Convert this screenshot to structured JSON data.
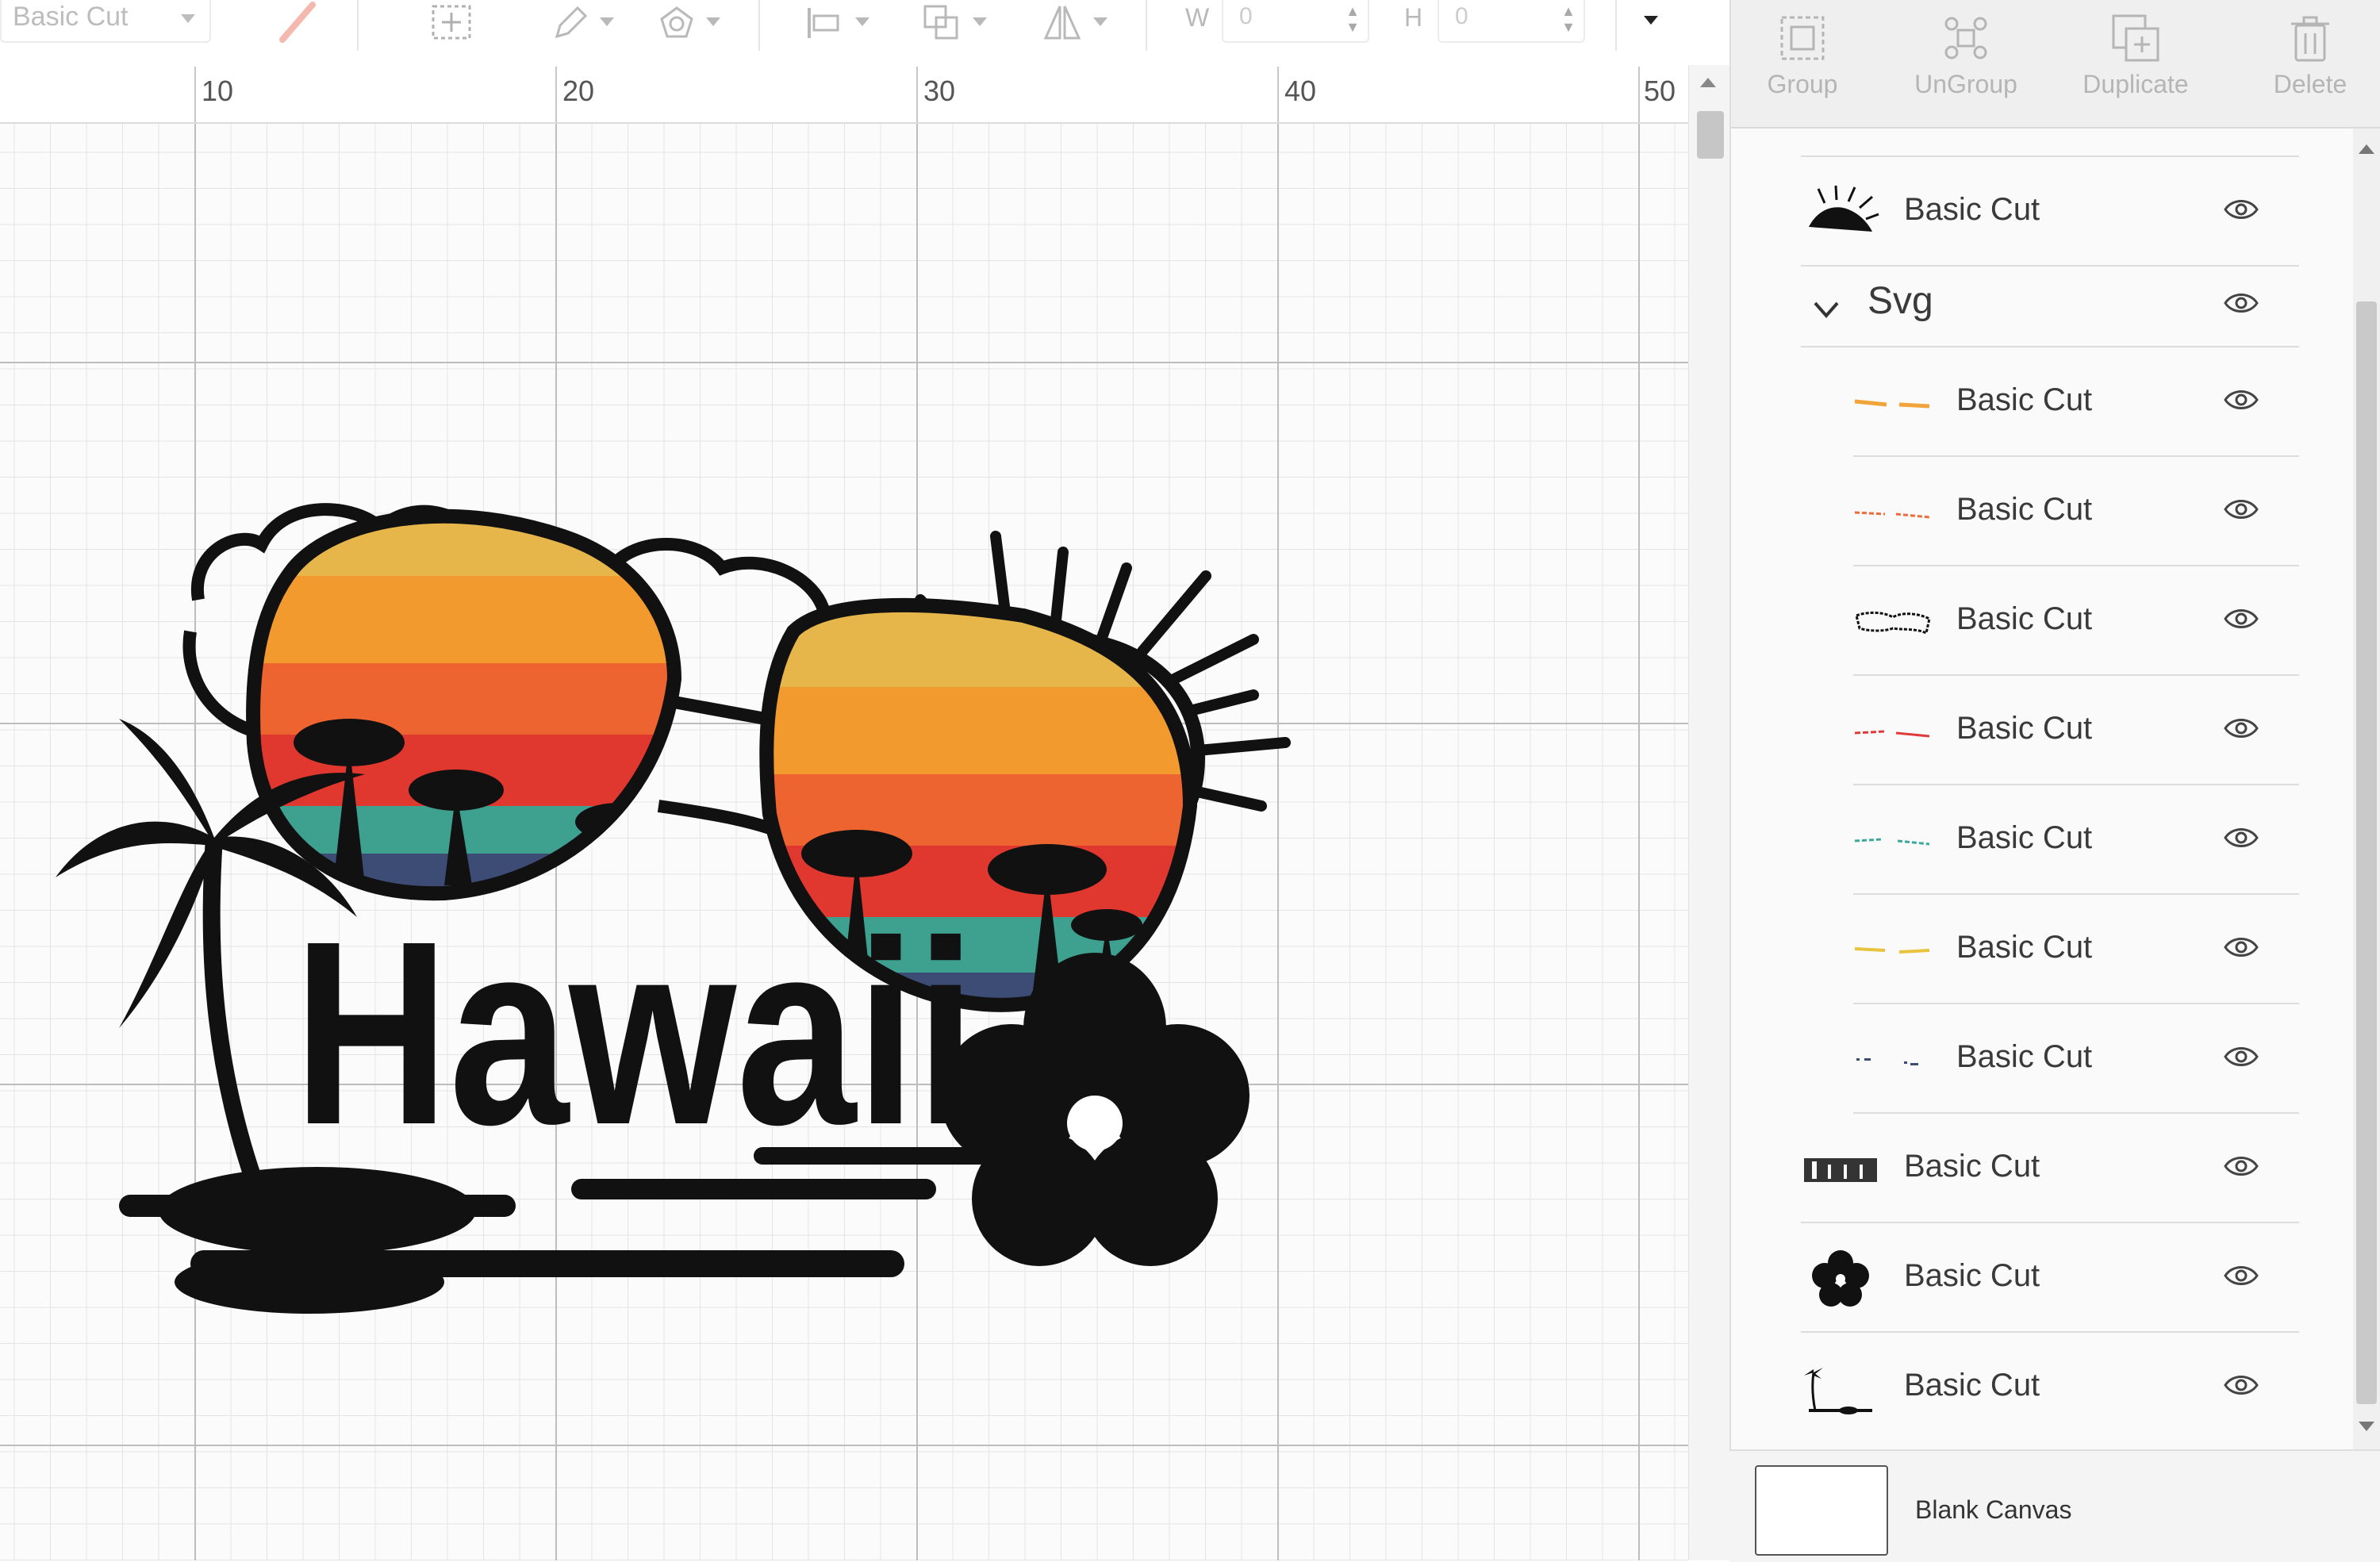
{
  "toolbar": {
    "operation_select": "Basic Cut",
    "width_label": "W",
    "width_value": "0",
    "height_label": "H",
    "height_value": "0",
    "icons": [
      "pen-color-icon",
      "add-frame-icon",
      "edit-icon",
      "offset-icon",
      "align-icon",
      "arrange-icon",
      "flip-icon",
      "more-caret-icon"
    ]
  },
  "ruler": {
    "labels": [
      "10",
      "20",
      "30",
      "40",
      "50"
    ]
  },
  "actions": {
    "group": "Group",
    "ungroup": "UnGroup",
    "duplicate": "Duplicate",
    "delete": "Delete"
  },
  "layers": {
    "rows": [
      {
        "label": "Basic Cut",
        "thumb": "sun-thumb"
      },
      {
        "label": "Svg",
        "thumb": "group-chevron"
      },
      {
        "label": "Basic Cut",
        "thumb": "orange-stripe",
        "color": "#f0a43a"
      },
      {
        "label": "Basic Cut",
        "thumb": "orange-red-stripe",
        "color": "#ee6b3a"
      },
      {
        "label": "Basic Cut",
        "thumb": "black-pattern"
      },
      {
        "label": "Basic Cut",
        "thumb": "red-stripe",
        "color": "#e03b3b"
      },
      {
        "label": "Basic Cut",
        "thumb": "teal-stripe",
        "color": "#3aa89a"
      },
      {
        "label": "Basic Cut",
        "thumb": "yellow-stripe",
        "color": "#e8c33d"
      },
      {
        "label": "Basic Cut",
        "thumb": "blue-dots",
        "color": "#3c4c74"
      },
      {
        "label": "Basic Cut",
        "thumb": "hawaii-text-thumb"
      },
      {
        "label": "Basic Cut",
        "thumb": "hibiscus-thumb"
      },
      {
        "label": "Basic Cut",
        "thumb": "palm-island-thumb"
      }
    ]
  },
  "artwork": {
    "text": "Hawaii",
    "stripe_colors": [
      "#e7b64a",
      "#f29a2e",
      "#ee6430",
      "#e0382f",
      "#3ea08f",
      "#3d4c74"
    ]
  },
  "blank_canvas": "Blank Canvas"
}
